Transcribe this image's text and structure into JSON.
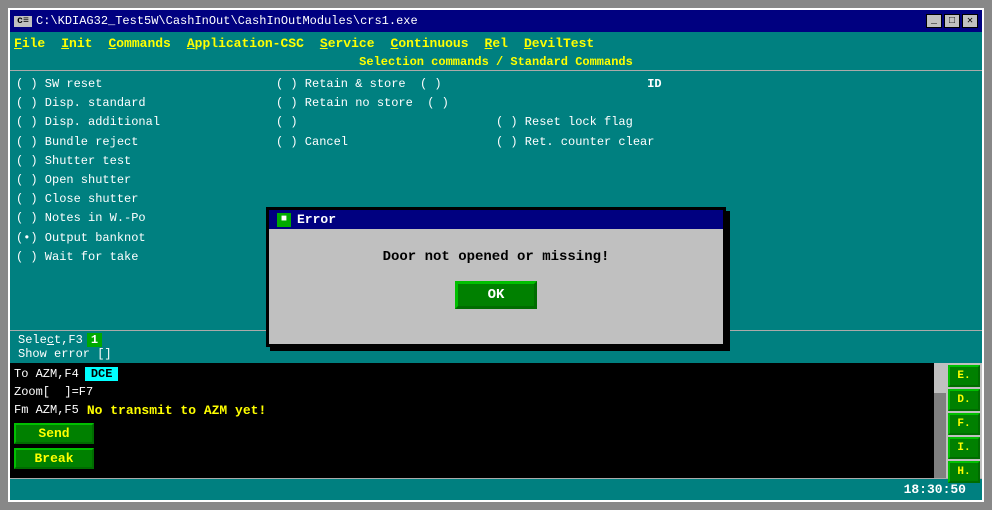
{
  "window": {
    "title": "C:\\KDIAG32_Test5W\\CashInOut\\CashInOutModules\\crs1.exe",
    "title_icon": "c≡",
    "controls": [
      "_",
      "□",
      "✕"
    ]
  },
  "menu": {
    "items": [
      {
        "id": "file",
        "label": "File",
        "underline_index": 0
      },
      {
        "id": "init",
        "label": "Init",
        "underline_index": 0
      },
      {
        "id": "commands",
        "label": "Commands",
        "underline_index": 0
      },
      {
        "id": "application_csc",
        "label": "Application-CSC",
        "underline_index": 0
      },
      {
        "id": "service",
        "label": "Service",
        "underline_index": 0
      },
      {
        "id": "continuous",
        "label": "Continuous",
        "underline_index": 0
      },
      {
        "id": "rel",
        "label": "Rel",
        "underline_index": 0
      },
      {
        "id": "deviltest",
        "label": "DevilTest",
        "underline_index": 0
      }
    ]
  },
  "section_header": "Selection commands / Standard Commands",
  "col1_items": [
    {
      "radio": "( )",
      "label": "SW reset"
    },
    {
      "radio": "( )",
      "label": "Disp. standard"
    },
    {
      "radio": "( )",
      "label": "Disp. additional"
    },
    {
      "radio": "( )",
      "label": "Bundle reject"
    },
    {
      "radio": "( )",
      "label": "Shutter test"
    },
    {
      "radio": "( )",
      "label": "Open shutter"
    },
    {
      "radio": "( )",
      "label": "Close shutter"
    },
    {
      "radio": "( )",
      "label": "Notes in W.-Po"
    },
    {
      "radio": "(•)",
      "label": "Output banknot"
    },
    {
      "radio": "( )",
      "label": "Wait for take"
    }
  ],
  "col2_items": [
    {
      "radio": "( )",
      "label": "Retain & store"
    },
    {
      "radio": "( )",
      "label": "Retain no store"
    },
    {
      "radio": "( )",
      "label": ""
    },
    {
      "radio": "( )",
      "label": "Cancel"
    }
  ],
  "col3_items": [
    {
      "radio": "( )",
      "label": ""
    },
    {
      "radio": "( )",
      "label": ""
    },
    {
      "radio": "( )",
      "label": "Reset lock flag"
    },
    {
      "radio": "( )",
      "label": "Ret. counter clear"
    }
  ],
  "select_row": {
    "prefix": "Select,F3",
    "value": "1",
    "suffix": ""
  },
  "show_error_row": {
    "prefix": "Show error [",
    "value": " ",
    "suffix": "]"
  },
  "bottom": {
    "to_azm": "To AZM,F4",
    "dce_label": "DCE",
    "zoom_row": "Zoom[  ]=F7",
    "fm_azm": "Fm AZM,F5",
    "no_transmit": "No transmit to AZM yet!",
    "send_label": "Send",
    "break_label": "Break"
  },
  "right_buttons": [
    "E.",
    "D.",
    "F.",
    "I.",
    "H."
  ],
  "status_bar": {
    "time": "18:30:50"
  },
  "dialog": {
    "title_icon": "■",
    "title": "Error",
    "message": "Door not opened or missing!",
    "ok_label": "OK"
  }
}
